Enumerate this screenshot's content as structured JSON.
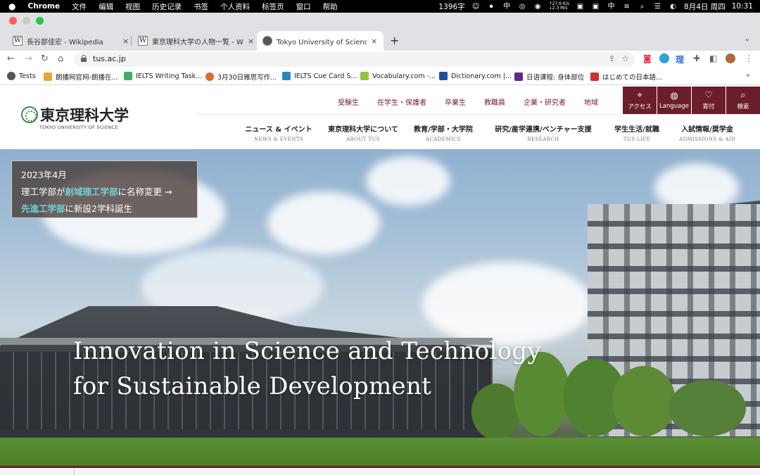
{
  "menubar": {
    "apple": "",
    "app": "Chrome",
    "items": [
      "文件",
      "编辑",
      "视图",
      "历史记录",
      "书签",
      "个人资料",
      "标签页",
      "窗口",
      "帮助"
    ],
    "wordcount": "1396字",
    "speed_up": "↑27.6 K/s",
    "speed_down": "↓2.3 M/s",
    "ime": "中",
    "date": "8月4日 周四",
    "time": "10:31"
  },
  "tabs": [
    {
      "favicon": "W",
      "title": "長谷部佳宏 - Wikipedia",
      "close": "×"
    },
    {
      "favicon": "W",
      "title": "東京理科大学の人物一覧 - Wikipedia",
      "close": "×"
    },
    {
      "favicon": "●",
      "title": "Tokyo University of Science | 東京理科大学",
      "close": "×"
    }
  ],
  "browser": {
    "new_tab": "+",
    "url": "tus.ac.jp",
    "ext_ri": "理"
  },
  "bookmarks": [
    {
      "label": "Tests",
      "color": "#555555"
    },
    {
      "label": "朗播网官网-朗播在...",
      "color": "#e8a53a"
    },
    {
      "label": "IELTS Writing Task...",
      "color": "#3fae6a"
    },
    {
      "label": "3月30日雅思写作...",
      "color": "#e06a2b"
    },
    {
      "label": "IELTS Cue Card S...",
      "color": "#2b86c6"
    },
    {
      "label": "Vocabulary.com -...",
      "color": "#8cc63f"
    },
    {
      "label": "Dictionary.com |...",
      "color": "#1a4fa0"
    },
    {
      "label": "日语课程: 身体部位",
      "color": "#5b2a86"
    },
    {
      "label": "はじめての日本語...",
      "color": "#c33"
    }
  ],
  "site": {
    "logo_jp": "東京理科大学",
    "logo_en": "TOKYO UNIVERSITY OF SCIENCE",
    "util_nav": [
      "受験生",
      "在学生・保護者",
      "卒業生",
      "教職員",
      "企業・研究者",
      "地域"
    ],
    "icon_buttons": [
      {
        "icon": "location-icon",
        "label": "アクセス"
      },
      {
        "icon": "globe-icon",
        "label": "Language"
      },
      {
        "icon": "gift-icon",
        "label": "寄付"
      },
      {
        "icon": "search-icon",
        "label": "検索"
      }
    ],
    "main_nav": [
      {
        "jp": "ニュース & イベント",
        "en": "NEWS & EVENTS"
      },
      {
        "jp": "東京理科大学について",
        "en": "ABOUT TUS"
      },
      {
        "jp": "教育/学部・大学院",
        "en": "ACADEMICS"
      },
      {
        "jp": "研究/産学連携/ベンチャー支援",
        "en": "RESEARCH"
      },
      {
        "jp": "学生生活/就職",
        "en": "TUS LIFE"
      },
      {
        "jp": "入試情報/奨学金",
        "en": "ADMISSIONS & AID"
      }
    ],
    "news": {
      "date": "2023年4月",
      "line1_pre": "理工学部が",
      "line1_hl": "創域理工学部",
      "line1_post": "に名称変更 →",
      "line2_hl": "先進工学部",
      "line2_post": "に新設2学科誕生"
    },
    "tagline_1": "Innovation in Science and Technology",
    "tagline_2": "for Sustainable Development"
  },
  "colors": {
    "brand": "#6b1d2c",
    "highlight": "#6fd0d6",
    "logo_green": "#3a8a4c"
  }
}
